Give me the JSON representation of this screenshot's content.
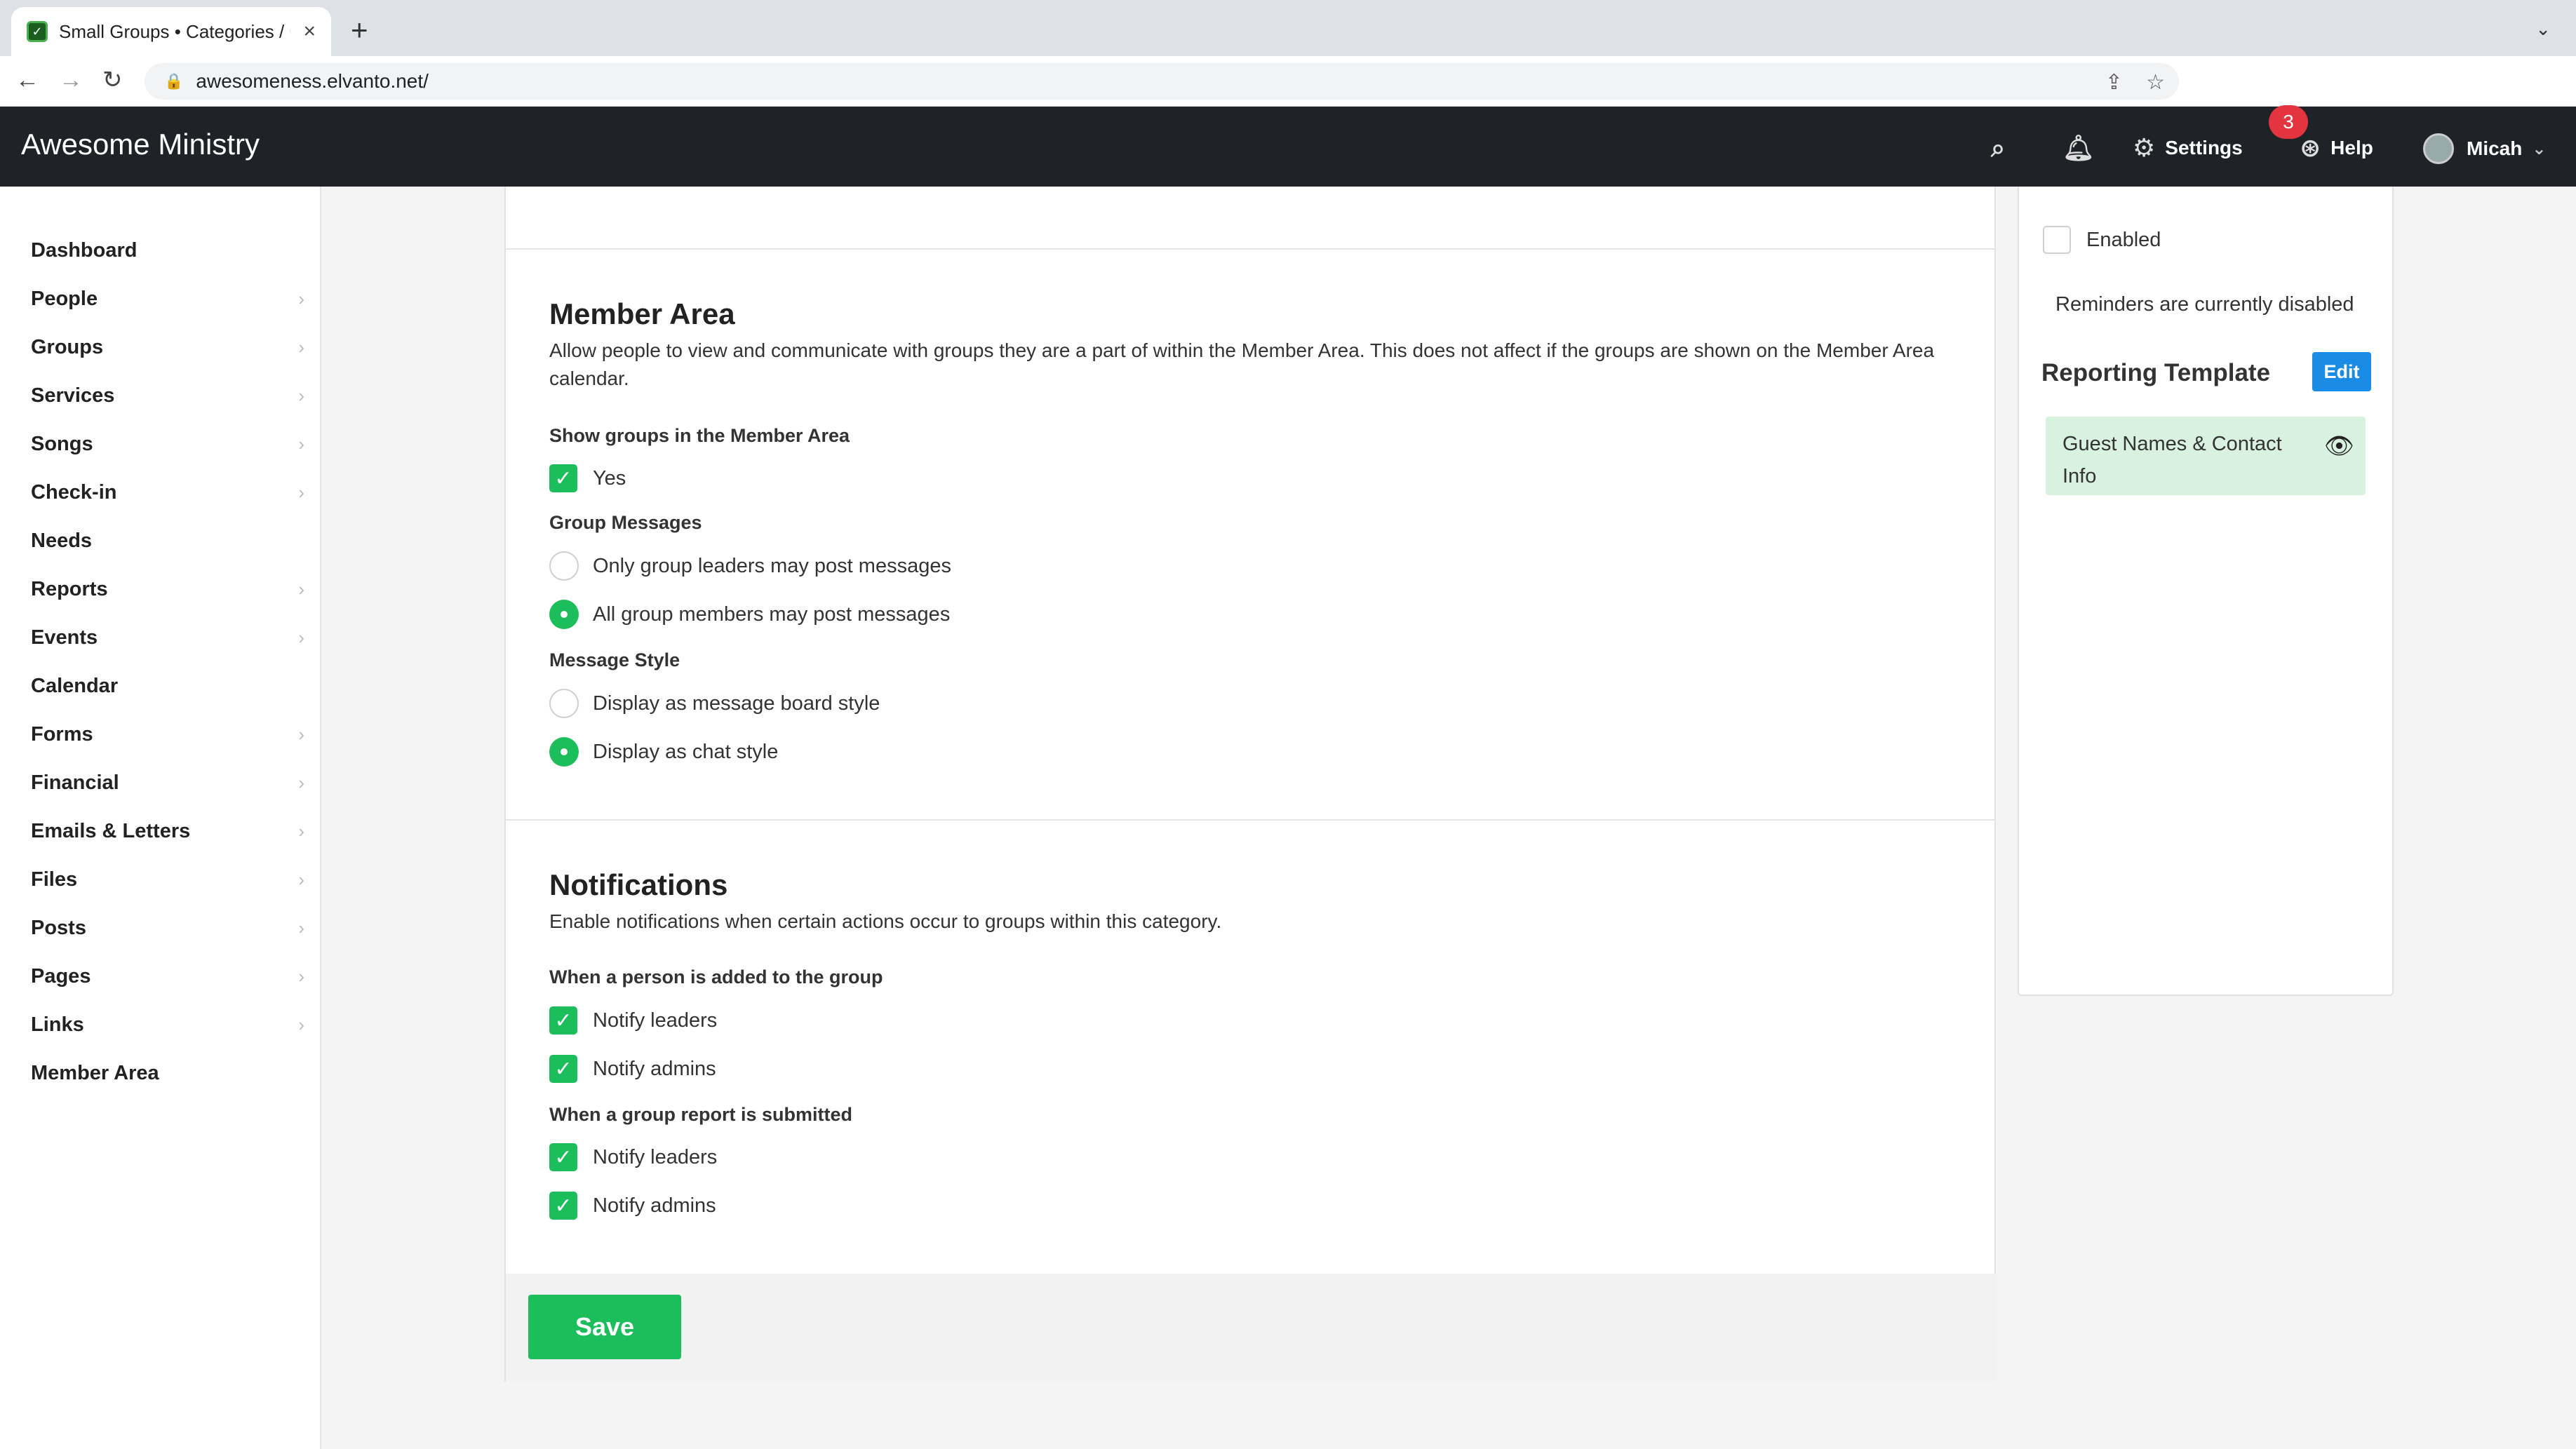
{
  "browser": {
    "tab_title": "Small Groups • Categories / Gr",
    "url": "awesomeness.elvanto.net/"
  },
  "header": {
    "brand": "Awesome Ministry",
    "settings": "Settings",
    "help": "Help",
    "user": "Micah",
    "notification_count": "3"
  },
  "sidebar": {
    "items": [
      {
        "label": "Dashboard",
        "chevron": ""
      },
      {
        "label": "People",
        "chevron": "›"
      },
      {
        "label": "Groups",
        "chevron": "›"
      },
      {
        "label": "Services",
        "chevron": "›"
      },
      {
        "label": "Songs",
        "chevron": "›"
      },
      {
        "label": "Check-in",
        "chevron": "›"
      },
      {
        "label": "Needs",
        "chevron": ""
      },
      {
        "label": "Reports",
        "chevron": "›"
      },
      {
        "label": "Events",
        "chevron": "›"
      },
      {
        "label": "Calendar",
        "chevron": ""
      },
      {
        "label": "Forms",
        "chevron": "›"
      },
      {
        "label": "Financial",
        "chevron": "›"
      },
      {
        "label": "Emails & Letters",
        "chevron": "›"
      },
      {
        "label": "Files",
        "chevron": "›"
      },
      {
        "label": "Posts",
        "chevron": "›"
      },
      {
        "label": "Pages",
        "chevron": "›"
      },
      {
        "label": "Links",
        "chevron": "›"
      },
      {
        "label": "Member Area",
        "chevron": ""
      }
    ]
  },
  "member_area": {
    "title": "Member Area",
    "description": "Allow people to view and communicate with groups they are a part of within the Member Area. This does not affect if the groups are shown on the Member Area calendar.",
    "show_groups_label": "Show groups in the Member Area",
    "show_groups_yes": "Yes",
    "group_messages_label": "Group Messages",
    "msg_opt_leaders": "Only group leaders may post messages",
    "msg_opt_all": "All group members may post messages",
    "message_style_label": "Message Style",
    "style_opt_board": "Display as message board style",
    "style_opt_chat": "Display as chat style"
  },
  "notifications": {
    "title": "Notifications",
    "description": "Enable notifications when certain actions occur to groups within this category.",
    "added_label": "When a person is added to the group",
    "report_label": "When a group report is submitted",
    "notify_leaders": "Notify leaders",
    "notify_admins": "Notify admins"
  },
  "footer": {
    "save_label": "Save"
  },
  "right_panel": {
    "enabled_label": "Enabled",
    "reminder_status": "Reminders are currently disabled",
    "reporting_template_title": "Reporting Template",
    "edit_label": "Edit",
    "template_name": "Guest Names & Contact Info"
  },
  "colors": {
    "accent_green": "#1cbe5c",
    "edit_blue": "#1a8ce6",
    "header_bg": "#1f2327",
    "badge_red": "#e3343f"
  }
}
